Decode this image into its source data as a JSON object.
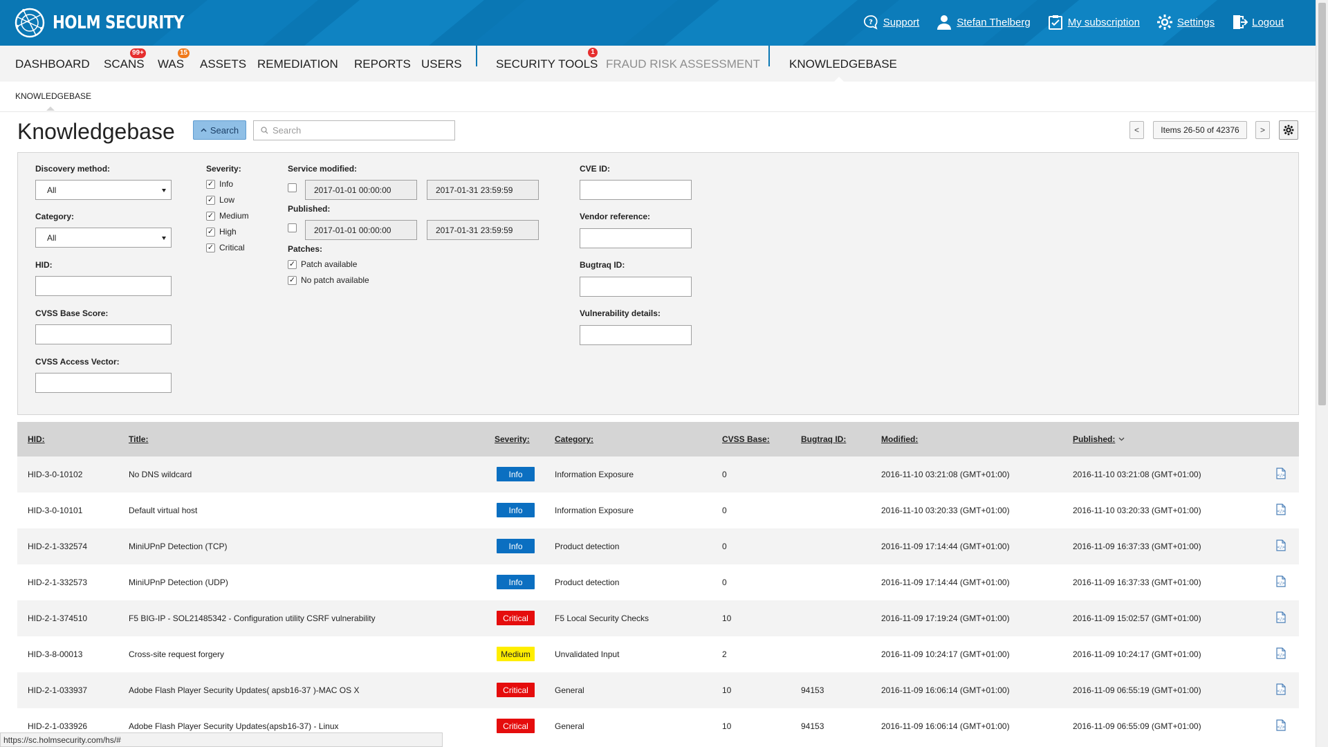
{
  "header": {
    "logo_text": "HOLM SECURITY",
    "links": [
      {
        "label": "Support",
        "icon": "help-bubble-icon"
      },
      {
        "label": "Stefan Thelberg",
        "icon": "user-icon"
      },
      {
        "label": "My subscription",
        "icon": "clipboard-icon"
      },
      {
        "label": "Settings",
        "icon": "gear-icon"
      },
      {
        "label": "Logout",
        "icon": "logout-icon"
      }
    ],
    "bg_color": "#0a77b4"
  },
  "nav": {
    "items": [
      {
        "label": "DASHBOARD"
      },
      {
        "label": "SCANS",
        "badge": "99+"
      },
      {
        "label": "WAS",
        "badge": "15"
      },
      {
        "label": "ASSETS"
      },
      {
        "label": "REMEDIATION"
      },
      {
        "label": "REPORTS"
      },
      {
        "label": "USERS"
      },
      {
        "label": "SECURITY TOOLS",
        "badge": "1"
      },
      {
        "label": "FRAUD RISK ASSESSMENT"
      },
      {
        "label": "KNOWLEDGEBASE"
      }
    ],
    "active": "KNOWLEDGEBASE"
  },
  "breadcrumb": "KNOWLEDGEBASE",
  "page": {
    "title": "Knowledgebase",
    "search_button": "Search",
    "search_placeholder": "Search",
    "pager": {
      "prev": "<",
      "next": ">",
      "info": "Items 26-50 of 42376"
    }
  },
  "filters": {
    "discovery_method": {
      "label": "Discovery method:",
      "value": "All"
    },
    "category": {
      "label": "Category:",
      "value": "All"
    },
    "hid": {
      "label": "HID:"
    },
    "cvss_base_score": {
      "label": "CVSS Base Score:"
    },
    "cvss_access_vector": {
      "label": "CVSS Access Vector:"
    },
    "severity": {
      "label": "Severity:",
      "options": [
        {
          "label": "Info",
          "checked": true
        },
        {
          "label": "Low",
          "checked": true
        },
        {
          "label": "Medium",
          "checked": true
        },
        {
          "label": "High",
          "checked": true
        },
        {
          "label": "Critical",
          "checked": true
        }
      ]
    },
    "service_modified": {
      "label": "Service modified:",
      "checked": false,
      "from": "2017-01-01 00:00:00",
      "to": "2017-01-31 23:59:59"
    },
    "published": {
      "label": "Published:",
      "checked": false,
      "from": "2017-01-01 00:00:00",
      "to": "2017-01-31 23:59:59"
    },
    "patches": {
      "label": "Patches:",
      "options": [
        {
          "label": "Patch available",
          "checked": true
        },
        {
          "label": "No patch available",
          "checked": true
        }
      ]
    },
    "cve_id": {
      "label": "CVE ID:"
    },
    "vendor_reference": {
      "label": "Vendor reference:"
    },
    "bugtraq_id": {
      "label": "Bugtraq ID:"
    },
    "vulnerability_details": {
      "label": "Vulnerability details:"
    }
  },
  "table": {
    "columns": {
      "hid": "HID:",
      "title": "Title:",
      "severity": "Severity:",
      "category": "Category:",
      "cvss": "CVSS Base:",
      "bugtraq": "Bugtraq ID:",
      "modified": "Modified:",
      "published": "Published:"
    },
    "rows": [
      {
        "hid": "HID-3-0-10102",
        "title": "No DNS wildcard",
        "severity": "Info",
        "category": "Information Exposure",
        "cvss": "0",
        "bugtraq": "",
        "modified": "2016-11-10 03:21:08 (GMT+01:00)",
        "published": "2016-11-10 03:21:08 (GMT+01:00)"
      },
      {
        "hid": "HID-3-0-10101",
        "title": "Default virtual host",
        "severity": "Info",
        "category": "Information Exposure",
        "cvss": "0",
        "bugtraq": "",
        "modified": "2016-11-10 03:20:33 (GMT+01:00)",
        "published": "2016-11-10 03:20:33 (GMT+01:00)"
      },
      {
        "hid": "HID-2-1-332574",
        "title": "MiniUPnP Detection (TCP)",
        "severity": "Info",
        "category": "Product detection",
        "cvss": "0",
        "bugtraq": "",
        "modified": "2016-11-09 17:14:44 (GMT+01:00)",
        "published": "2016-11-09 16:37:33 (GMT+01:00)"
      },
      {
        "hid": "HID-2-1-332573",
        "title": "MiniUPnP Detection (UDP)",
        "severity": "Info",
        "category": "Product detection",
        "cvss": "0",
        "bugtraq": "",
        "modified": "2016-11-09 17:14:44 (GMT+01:00)",
        "published": "2016-11-09 16:37:33 (GMT+01:00)"
      },
      {
        "hid": "HID-2-1-374510",
        "title": "F5 BIG-IP - SOL21485342 - Configuration utility CSRF vulnerability",
        "severity": "Critical",
        "category": "F5 Local Security Checks",
        "cvss": "10",
        "bugtraq": "",
        "modified": "2016-11-09 17:19:24 (GMT+01:00)",
        "published": "2016-11-09 15:02:57 (GMT+01:00)"
      },
      {
        "hid": "HID-3-8-00013",
        "title": "Cross-site request forgery",
        "severity": "Medium",
        "category": "Unvalidated Input",
        "cvss": "2",
        "bugtraq": "",
        "modified": "2016-11-09 10:24:17 (GMT+01:00)",
        "published": "2016-11-09 10:24:17 (GMT+01:00)"
      },
      {
        "hid": "HID-2-1-033937",
        "title": "Adobe Flash Player Security Updates( apsb16-37 )-MAC OS X",
        "severity": "Critical",
        "category": "General",
        "cvss": "10",
        "bugtraq": "94153",
        "modified": "2016-11-09 16:06:14 (GMT+01:00)",
        "published": "2016-11-09 06:55:19 (GMT+01:00)"
      },
      {
        "hid": "HID-2-1-033926",
        "title": "Adobe Flash Player Security Updates(apsb16-37) - Linux",
        "severity": "Critical",
        "category": "General",
        "cvss": "10",
        "bugtraq": "94153",
        "modified": "2016-11-09 16:06:14 (GMT+01:00)",
        "published": "2016-11-09 06:55:09 (GMT+01:00)"
      }
    ]
  },
  "status_url": "https://sc.holmsecurity.com/hs/#",
  "colors": {
    "info": "#0b6fc1",
    "critical": "#e50d0d",
    "medium": "#ffee00"
  }
}
